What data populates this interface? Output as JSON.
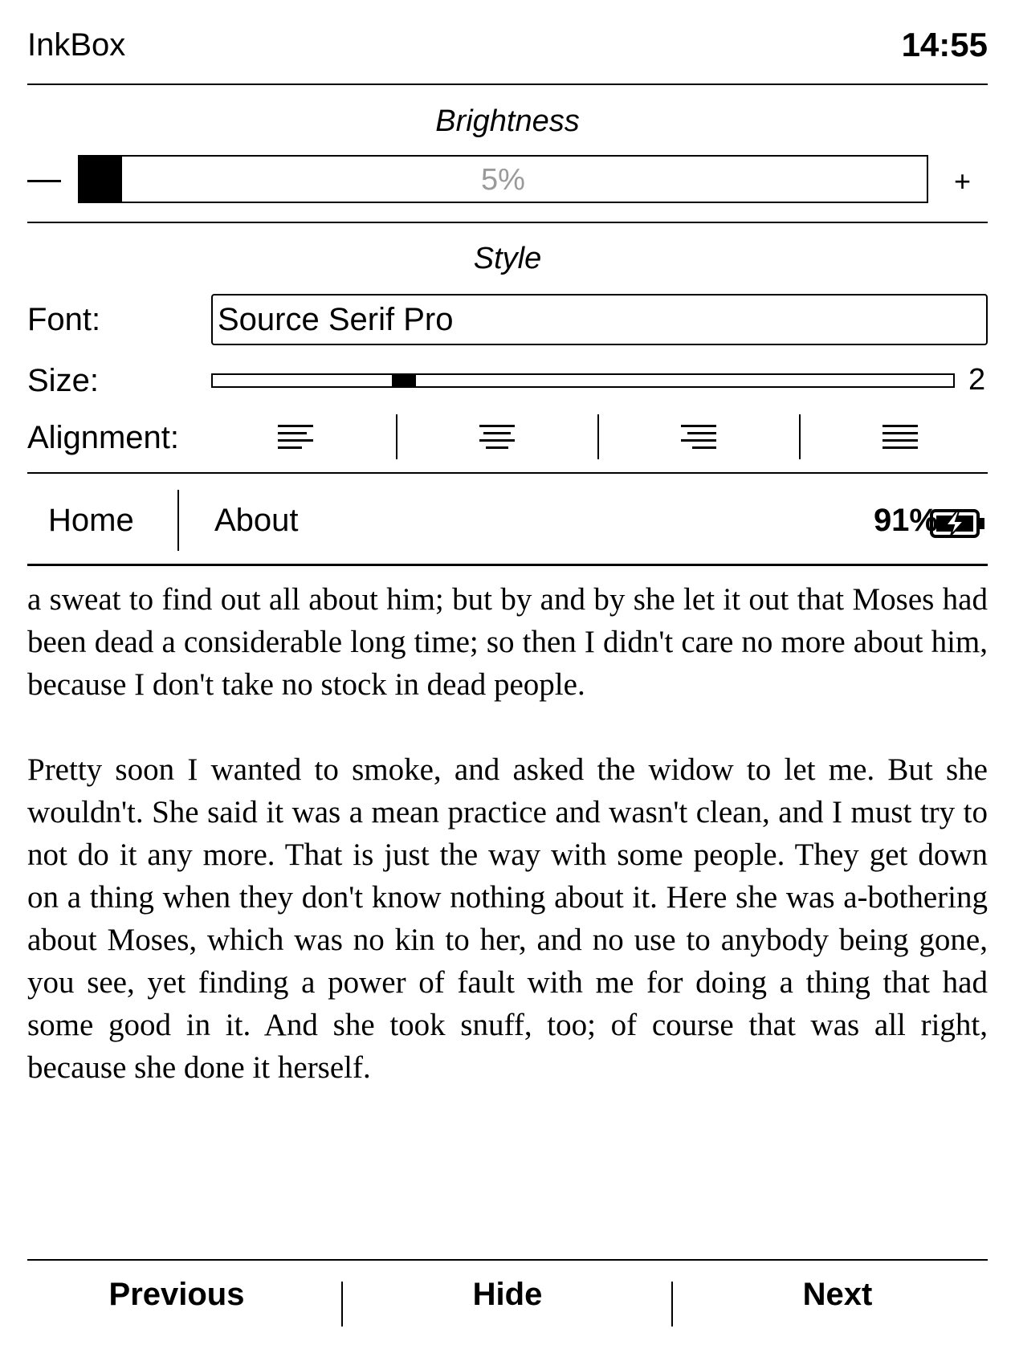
{
  "status_bar": {
    "app_name": "InkBox",
    "time": "14:55"
  },
  "brightness": {
    "title": "Brightness",
    "minus_label": "—",
    "plus_label": "+",
    "value_text": "5%",
    "level_percent": 5
  },
  "style": {
    "title": "Style",
    "font_label": "Font:",
    "font_value": "Source Serif Pro",
    "size_label": "Size:",
    "size_value": "2",
    "size_level_fraction": 0.25,
    "alignment_label": "Alignment:",
    "alignment_options": [
      "align-left-icon",
      "align-center-icon",
      "align-right-icon",
      "align-justify-icon"
    ]
  },
  "nav": {
    "home": "Home",
    "about": "About",
    "battery_percent": "91%",
    "battery_state": "charging"
  },
  "reader": {
    "paragraphs": [
      "a sweat to find out all about him; but by and by she let it out that Moses had been dead a considerable long time; so then I didn't care no more about him, because I don't take no stock in dead people.",
      "Pretty soon I wanted to smoke, and asked the widow to let me. But she wouldn't. She said it was a mean practice and wasn't clean, and I must try to not do it any more. That is just the way with some people. They get down on a thing when they don't know nothing about it. Here she was a-bothering about Moses, which was no kin to her, and no use to anybody being gone, you see, yet finding a power of fault with me for doing a thing that had some good in it. And she took snuff, too; of course that was all right, because she done it herself."
    ]
  },
  "bottom_bar": {
    "previous": "Previous",
    "hide": "Hide",
    "next": "Next"
  }
}
